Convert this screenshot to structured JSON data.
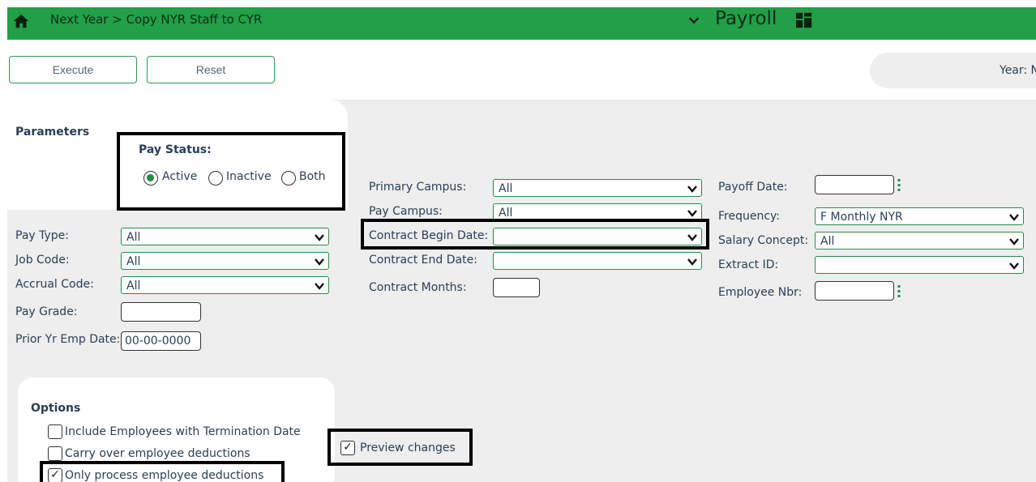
{
  "header": {
    "breadcrumb": "Next Year > Copy NYR Staff to CYR",
    "module": "Payroll"
  },
  "toolbar": {
    "execute_label": "Execute",
    "reset_label": "Reset",
    "year_label": "Year: N"
  },
  "parameters": {
    "title": "Parameters",
    "pay_status": {
      "label": "Pay Status:",
      "options": [
        "Active",
        "Inactive",
        "Both"
      ],
      "selected": "Active"
    },
    "pay_type": {
      "label": "Pay Type:",
      "value": "All"
    },
    "job_code": {
      "label": "Job Code:",
      "value": "All"
    },
    "accrual_code": {
      "label": "Accrual Code:",
      "value": "All"
    },
    "pay_grade": {
      "label": "Pay Grade:",
      "value": ""
    },
    "prior_yr_emp_date": {
      "label": "Prior Yr Emp Date:",
      "value": "00-00-0000"
    },
    "primary_campus": {
      "label": "Primary Campus:",
      "value": "All"
    },
    "pay_campus": {
      "label": "Pay Campus:",
      "value": "All"
    },
    "contract_begin_date": {
      "label": "Contract Begin Date:",
      "value": ""
    },
    "contract_end_date": {
      "label": "Contract End Date:",
      "value": ""
    },
    "contract_months": {
      "label": "Contract Months:",
      "value": ""
    },
    "payoff_date": {
      "label": "Payoff Date:",
      "value": ""
    },
    "frequency": {
      "label": "Frequency:",
      "value": "F Monthly NYR"
    },
    "salary_concept": {
      "label": "Salary Concept:",
      "value": "All"
    },
    "extract_id": {
      "label": "Extract ID:",
      "value": ""
    },
    "employee_nbr": {
      "label": "Employee Nbr:",
      "value": ""
    }
  },
  "options": {
    "title": "Options",
    "include_terminated": {
      "label": "Include Employees with Termination Date",
      "checked": false
    },
    "carry_over_deductions": {
      "label": "Carry over employee deductions",
      "checked": false
    },
    "only_process_deductions": {
      "label": "Only process employee deductions",
      "checked": true
    },
    "preview_changes": {
      "label": "Preview changes",
      "checked": true
    }
  },
  "colors": {
    "header_green": "#21a047",
    "panel_gray": "#eeeeee",
    "field_border": "#2a8a4a"
  },
  "icons": [
    "home-icon",
    "chevron-down-icon",
    "grid-icon",
    "caret-down-icon",
    "kebab-icon",
    "check-icon"
  ]
}
